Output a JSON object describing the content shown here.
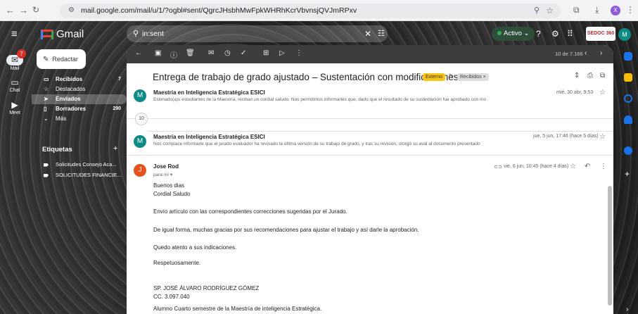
{
  "browser": {
    "url": "mail.google.com/mail/u/1/?ogbl#sent/QgrcJHsbhMwFpkWHRhKcrVbvnsjQVJmRPxv",
    "profile_initial": "X"
  },
  "app": {
    "name": "Gmail",
    "search_query": "in:sent",
    "status": "Activo",
    "org_logo_text": "SEDOC 360",
    "avatar_initial": "M"
  },
  "rail": {
    "mail_label": "Mail",
    "mail_badge": "7",
    "chat_label": "Chat",
    "meet_label": "Meet"
  },
  "sidebar": {
    "compose_label": "Redactar",
    "items": [
      {
        "label": "Recibidos",
        "count": "7"
      },
      {
        "label": "Destacados",
        "count": ""
      },
      {
        "label": "Enviados",
        "count": ""
      },
      {
        "label": "Borradores",
        "count": "290"
      },
      {
        "label": "Más",
        "count": ""
      }
    ],
    "labels_title": "Etiquetas",
    "labels": [
      {
        "label": "Solicitudes Consejo Aca..."
      },
      {
        "label": "SOLICITUDES FINANCIE..."
      }
    ]
  },
  "thread": {
    "pager": "10 de 7.166",
    "subject": "Entrega de trabajo de grado ajustado – Sustentación con modificaciones",
    "chip_external": "Externo",
    "chip_inbox": "Recibidos ×",
    "collapsed_count": "10",
    "messages": [
      {
        "avatar": "M",
        "sender": "Maestría en Inteligencia Estratégica ESICI",
        "snippet": "Estimado(a)s estudiantes de la Maestría, reciban un cordial saludo. Nos permitimos informarles que, dado que el resultado de su sustentación fue aprobado con mo",
        "date": "mié, 30 abr, 9:53"
      },
      {
        "avatar": "M",
        "sender": "Maestría en Inteligencia Estratégica ESICI",
        "snippet": "Nos complace informarle que el jurado evaluador ha revisado la última versión de su trabajo de grado, y tras su revisión, otorgó su aval al documento presentado",
        "date": "jue, 5 jun, 17:46 (hace 5 días)"
      }
    ],
    "open_message": {
      "avatar": "J",
      "sender": "Jose Rod",
      "to": "para mí ▾",
      "date": "vie, 6 jun, 10:45 (hace 4 días)",
      "body": [
        "Buenos dias",
        "Cordial Saludo",
        "Envío artículo con las correspondientes correcciones sugeridas por el Jurado.",
        "De igual forma, muchas gracias por sus recomendaciones para ajustar el trabajo y así darle la aprobación.",
        "Quedo atento a sus indicaciones.",
        "Respetuosamente.",
        "SP. JOSÉ ÁLVARO RODRÍGUEZ GÓMEZ",
        "CC. 3.097.040",
        "Alumno Cuarto semestre de la Maestría de inteligencia Estratégica."
      ]
    }
  },
  "colors": {
    "accent_avatar": "#0b8a86",
    "jose_avatar": "#e8501e",
    "external_chip": "#f9c513"
  }
}
